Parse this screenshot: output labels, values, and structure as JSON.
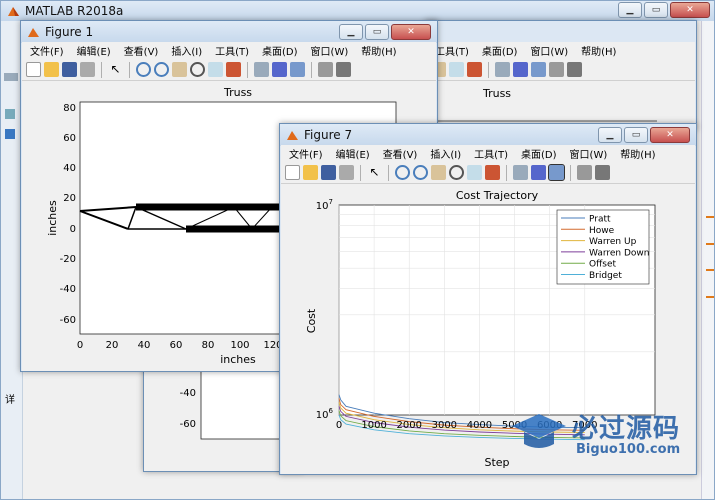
{
  "matlab": {
    "title": "MATLAB R2018a"
  },
  "figure1": {
    "title": "Figure 1",
    "plot_title": "Truss",
    "xlabel": "inches",
    "ylabel": "inches",
    "yticks": [
      "80",
      "60",
      "40",
      "20",
      "0",
      "-20",
      "-40",
      "-60"
    ],
    "xticks": [
      "0",
      "20",
      "40",
      "60",
      "80",
      "100",
      "120"
    ]
  },
  "figure7": {
    "title": "Figure 7",
    "plot_title": "Cost Trajectory",
    "xlabel": "Step",
    "ylabel": "Cost",
    "ytick_top": "10",
    "ytick_top_exp": "7",
    "ytick_bottom": "10",
    "ytick_bottom_exp": "6",
    "xticks": [
      "0",
      "1000",
      "2000",
      "3000",
      "4000",
      "5000",
      "6000",
      "7000"
    ]
  },
  "background_figure": {
    "plot_title": "Truss"
  },
  "lower_axes": {
    "yticks": [
      "-40",
      "-60"
    ]
  },
  "menus": [
    "文件(F)",
    "编辑(E)",
    "查看(V)",
    "插入(I)",
    "工具(T)",
    "桌面(D)",
    "窗口(W)",
    "帮助(H)"
  ],
  "side_label": "详",
  "watermark": {
    "text": "必过源码",
    "url": "Biguo100.com"
  },
  "chart_data": {
    "type": "line",
    "title": "Cost Trajectory",
    "xlabel": "Step",
    "ylabel": "Cost",
    "y_scale": "log",
    "ylim": [
      1000000,
      10000000
    ],
    "xlim": [
      0,
      9000
    ],
    "series": [
      {
        "name": "Pratt",
        "color": "#4a7ebb",
        "x": [
          0,
          50,
          200,
          1000,
          2000,
          3000,
          4000,
          5000,
          6000,
          7000
        ],
        "y": [
          1250000,
          1180000,
          1100000,
          1020000,
          960000,
          920000,
          900000,
          885000,
          875000,
          870000
        ]
      },
      {
        "name": "Howe",
        "color": "#d46a2e",
        "x": [
          0,
          50,
          200,
          1000,
          2000,
          3000,
          4000,
          5000,
          6000,
          7000
        ],
        "y": [
          1200000,
          1120000,
          1060000,
          985000,
          930000,
          895000,
          875000,
          860000,
          850000,
          845000
        ]
      },
      {
        "name": "Warren Up",
        "color": "#e0b43c",
        "x": [
          0,
          50,
          200,
          1000,
          2000,
          3000,
          4000,
          5000,
          6000,
          7000
        ],
        "y": [
          1150000,
          1080000,
          1020000,
          950000,
          900000,
          870000,
          850000,
          838000,
          830000,
          825000
        ]
      },
      {
        "name": "Warren Down",
        "color": "#7e3f9a",
        "x": [
          0,
          50,
          200,
          1000,
          2000,
          3000,
          4000,
          5000,
          6000,
          7000
        ],
        "y": [
          1100000,
          1040000,
          985000,
          920000,
          875000,
          848000,
          830000,
          818000,
          810000,
          805000
        ]
      },
      {
        "name": "Offset",
        "color": "#72ac48",
        "x": [
          0,
          50,
          200,
          1000,
          2000,
          3000,
          4000,
          5000,
          6000,
          7000
        ],
        "y": [
          1050000,
          990000,
          940000,
          880000,
          840000,
          815000,
          800000,
          790000,
          782000,
          778000
        ]
      },
      {
        "name": "Bridget",
        "color": "#4fb0d8",
        "x": [
          0,
          50,
          200,
          1000,
          2000,
          3000,
          4000,
          5000,
          6000,
          7000
        ],
        "y": [
          1000000,
          950000,
          905000,
          850000,
          815000,
          795000,
          782000,
          773000,
          767000,
          763000
        ]
      }
    ]
  }
}
